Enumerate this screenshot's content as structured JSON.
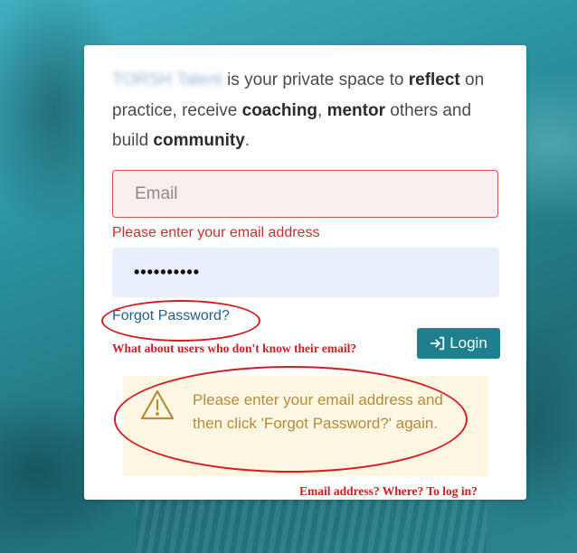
{
  "intro": {
    "brand": "TORSH Talent",
    "part1": " is your private space to ",
    "reflect": "reflect",
    "part2": " on practice, receive ",
    "coaching": "coaching",
    "part3": ", ",
    "mentor": "mentor",
    "part4": " others and build ",
    "community": "community",
    "part5": "."
  },
  "form": {
    "email_placeholder": "Email",
    "email_error": "Please enter your email address",
    "password_value": "••••••••••",
    "forgot_password": "Forgot Password?",
    "login_label": "Login"
  },
  "alert": {
    "text": "Please enter your email address and then click 'Forgot Password?' again."
  },
  "annotations": {
    "note1": "What about users who don't know their email?",
    "note2": "Email address? Where? To log in?"
  },
  "colors": {
    "error": "#d9534f",
    "button": "#1e7f8f",
    "alert_bg": "#fcf6e2",
    "alert_text": "#b58c3a",
    "annotation_red": "#d71920"
  },
  "icons": {
    "login": "sign-in-icon",
    "alert": "warning-triangle-icon"
  }
}
